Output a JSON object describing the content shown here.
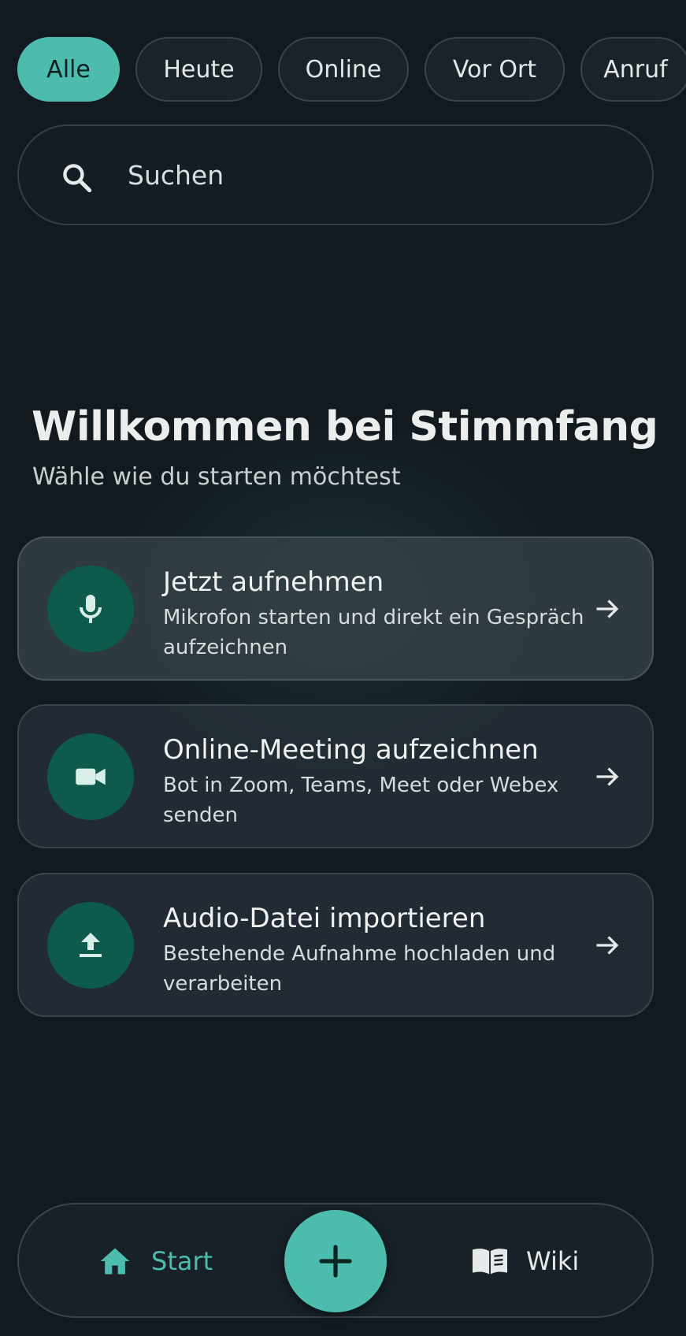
{
  "filters": {
    "chips": [
      "Alle",
      "Heute",
      "Online",
      "Vor Ort",
      "Anruf"
    ],
    "active": "Alle"
  },
  "search": {
    "placeholder": "Suchen",
    "value": ""
  },
  "welcome": {
    "title": "Willkommen bei Stimmfang",
    "subtitle": "Wähle wie du starten möchtest"
  },
  "actions": [
    {
      "icon": "microphone-icon",
      "title": "Jetzt aufnehmen",
      "description": "Mikrofon starten und direkt ein Gespräch aufzeichnen"
    },
    {
      "icon": "video-camera-icon",
      "title": "Online-Meeting aufzeichnen",
      "description": "Bot in Zoom, Teams, Meet oder Webex senden"
    },
    {
      "icon": "upload-icon",
      "title": "Audio-Datei importieren",
      "description": "Bestehende Aufnahme hochladen und verarbeiten"
    }
  ],
  "bottom_nav": {
    "start_label": "Start",
    "wiki_label": "Wiki",
    "fab_icon": "plus-icon"
  },
  "colors": {
    "accent": "#4dbcaf",
    "background": "#121a20",
    "icon_circle": "#0e5a4c"
  }
}
